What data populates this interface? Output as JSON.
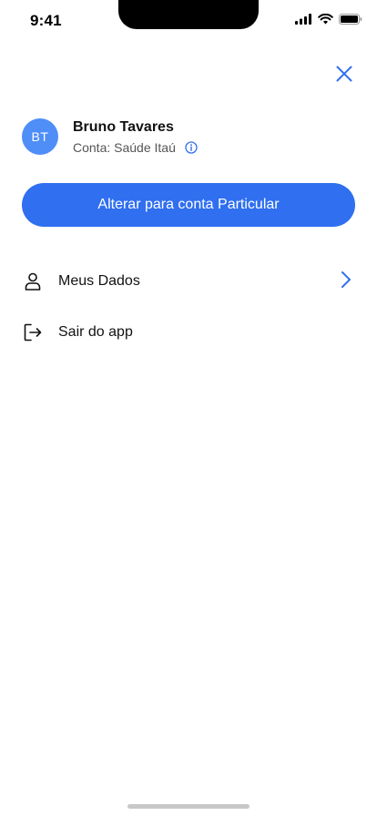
{
  "status_bar": {
    "time": "9:41",
    "icons": [
      "signal-icon",
      "wifi-icon",
      "battery-icon"
    ]
  },
  "header": {
    "close_icon": "close-icon"
  },
  "profile": {
    "initials": "BT",
    "name": "Bruno Tavares",
    "account": "Conta: Saúde Itaú",
    "info_icon": "info-icon"
  },
  "switch_account_button": {
    "label": "Alterar para conta Particular"
  },
  "menu": {
    "items": [
      {
        "label": "Meus Dados",
        "icon": "user-icon",
        "has_chevron": true
      },
      {
        "label": "Sair do app",
        "icon": "logout-icon",
        "has_chevron": false
      }
    ]
  },
  "colors": {
    "primary": "#2f6ff0",
    "avatar": "#4f8ef7",
    "text": "#111111",
    "secondary_text": "#555555"
  }
}
